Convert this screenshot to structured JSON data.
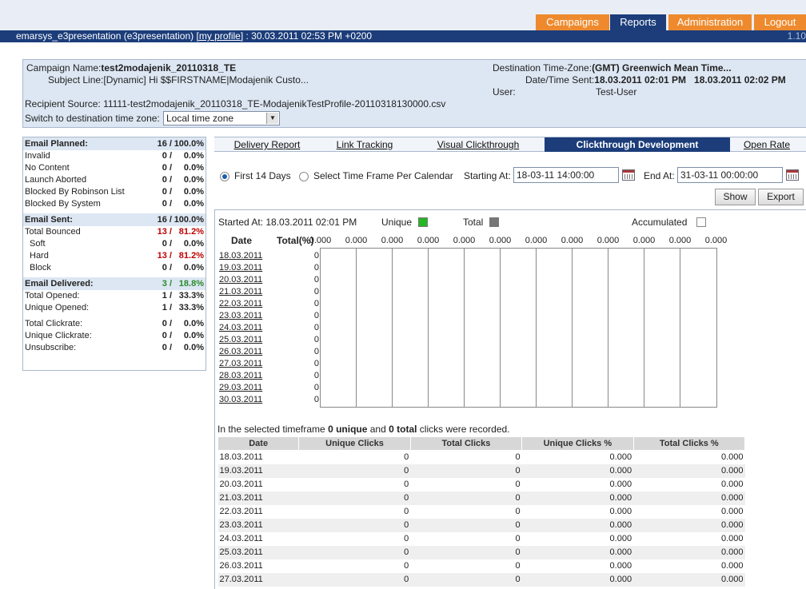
{
  "nav": {
    "tabs": [
      "Campaigns",
      "Reports",
      "Administration",
      "Logout"
    ],
    "active": "Reports"
  },
  "header": {
    "user_label": "emarsys_e3presentation (e3presentation)",
    "profile_link": "[my profile]",
    "datetime": ": 30.03.2011 02:53 PM +0200",
    "version": "1.10"
  },
  "campaign": {
    "name_label": "Campaign Name:",
    "name": "test2modajenik_20110318_TE",
    "subject_label": "Subject Line:",
    "subject": "[Dynamic] Hi $$FIRSTNAME|Modajenik Custo...",
    "source_label": "Recipient Source:",
    "source": "11111-test2modajenik_20110318_TE-ModajenikTestProfile-20110318130000.csv",
    "switch_label": "Switch to destination time zone:",
    "tz_value": "Local time zone",
    "dest_tz_label": "Destination Time-Zone:",
    "dest_tz": "(GMT) Greenwich Mean Time...",
    "sent_label": "Date/Time Sent:",
    "sent": "18.03.2011 02:01 PM   18.03.2011 02:02 PM",
    "user_label": "User:",
    "user": "Test-User"
  },
  "stats": [
    {
      "label": "Email Planned:",
      "n": "16 /",
      "p": "100.0%",
      "header": true
    },
    {
      "label": "Invalid",
      "n": "0 /",
      "p": "0.0%"
    },
    {
      "label": "No Content",
      "n": "0 /",
      "p": "0.0%"
    },
    {
      "label": "Launch Aborted",
      "n": "0 /",
      "p": "0.0%"
    },
    {
      "label": "Blocked By Robinson List",
      "n": "0 /",
      "p": "0.0%"
    },
    {
      "label": "Blocked By System",
      "n": "0 /",
      "p": "0.0%"
    },
    {
      "label": "Email Sent:",
      "n": "16 /",
      "p": "100.0%",
      "header": true
    },
    {
      "label": "Total Bounced",
      "n": "13 /",
      "p": "81.2%",
      "color": "red"
    },
    {
      "label": "Soft",
      "n": "0 /",
      "p": "0.0%",
      "indent": true
    },
    {
      "label": "Hard",
      "n": "13 /",
      "p": "81.2%",
      "color": "red",
      "indent": true
    },
    {
      "label": "Block",
      "n": "0 /",
      "p": "0.0%",
      "indent": true
    },
    {
      "label": "Email Delivered:",
      "n": "3 /",
      "p": "18.8%",
      "header": true,
      "color": "green"
    },
    {
      "label": "Total Opened:",
      "n": "1 /",
      "p": "33.3%"
    },
    {
      "label": "Unique Opened:",
      "n": "1 /",
      "p": "33.3%"
    },
    {
      "label": "Total Clickrate:",
      "n": "0 /",
      "p": "0.0%",
      "gap": true
    },
    {
      "label": "Unique Clickrate:",
      "n": "0 /",
      "p": "0.0%"
    },
    {
      "label": "Unsubscribe:",
      "n": "0 /",
      "p": "0.0%"
    }
  ],
  "report_tabs": [
    "Delivery Report",
    "Link Tracking",
    "Visual Clickthrough",
    "Clickthrough Development",
    "Open Rate"
  ],
  "active_report_tab": "Clickthrough Development",
  "filter": {
    "first14": "First 14 Days",
    "calendar": "Select Time Frame Per Calendar",
    "start_label": "Starting At:",
    "start": "18-03-11 14:00:00",
    "end_label": "End At:",
    "end": "31-03-11 00:00:00",
    "show": "Show",
    "export": "Export"
  },
  "chart": {
    "started": "Started At: 18.03.2011 02:01 PM",
    "unique_label": "Unique",
    "total_label": "Total",
    "accumulated_label": "Accumulated",
    "unique_color": "#22b822",
    "total_color": "#777777",
    "col_date": "Date",
    "col_total": "Total(%)",
    "scale": [
      "0.000",
      "0.000",
      "0.000",
      "0.000",
      "0.000",
      "0.000",
      "0.000",
      "0.000",
      "0.000",
      "0.000",
      "0.000",
      "0.000"
    ]
  },
  "chart_data": {
    "type": "bar",
    "categories": [
      "18.03.2011",
      "19.03.2011",
      "20.03.2011",
      "21.03.2011",
      "22.03.2011",
      "23.03.2011",
      "24.03.2011",
      "25.03.2011",
      "26.03.2011",
      "27.03.2011",
      "28.03.2011",
      "29.03.2011",
      "30.03.2011"
    ],
    "series": [
      {
        "name": "Unique",
        "values": [
          0,
          0,
          0,
          0,
          0,
          0,
          0,
          0,
          0,
          0,
          0,
          0,
          0
        ]
      },
      {
        "name": "Total",
        "values": [
          0,
          0,
          0,
          0,
          0,
          0,
          0,
          0,
          0,
          0,
          0,
          0,
          0
        ]
      }
    ],
    "totals": [
      "0",
      "0",
      "0",
      "0",
      "0",
      "0",
      "0",
      "0",
      "0",
      "0",
      "0",
      "0",
      "0"
    ]
  },
  "summary": {
    "pre": "In the selected timeframe ",
    "unique": "0 unique",
    "mid": " and ",
    "total": "0 total",
    "post": " clicks were recorded."
  },
  "table": {
    "headers": [
      "Date",
      "Unique Clicks",
      "Total Clicks",
      "Unique Clicks %",
      "Total Clicks %"
    ],
    "rows": [
      [
        "18.03.2011",
        "0",
        "0",
        "0.000",
        "0.000"
      ],
      [
        "19.03.2011",
        "0",
        "0",
        "0.000",
        "0.000"
      ],
      [
        "20.03.2011",
        "0",
        "0",
        "0.000",
        "0.000"
      ],
      [
        "21.03.2011",
        "0",
        "0",
        "0.000",
        "0.000"
      ],
      [
        "22.03.2011",
        "0",
        "0",
        "0.000",
        "0.000"
      ],
      [
        "23.03.2011",
        "0",
        "0",
        "0.000",
        "0.000"
      ],
      [
        "24.03.2011",
        "0",
        "0",
        "0.000",
        "0.000"
      ],
      [
        "25.03.2011",
        "0",
        "0",
        "0.000",
        "0.000"
      ],
      [
        "26.03.2011",
        "0",
        "0",
        "0.000",
        "0.000"
      ],
      [
        "27.03.2011",
        "0",
        "0",
        "0.000",
        "0.000"
      ]
    ]
  }
}
